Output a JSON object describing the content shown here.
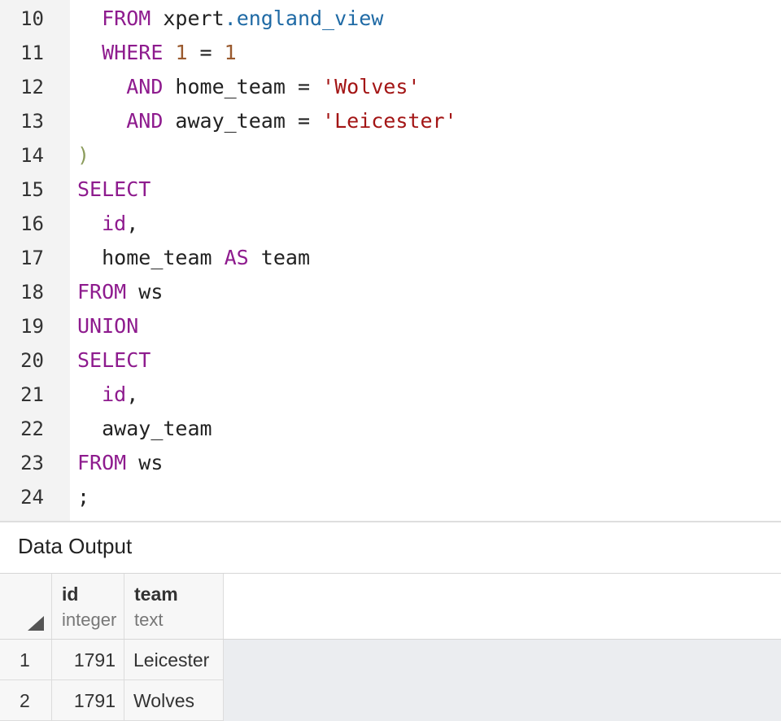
{
  "editor": {
    "colors": {
      "keyword": "#8e1b8e",
      "number": "#9a5a2e",
      "string": "#a31515",
      "property": "#1f6aa5",
      "paren": "#8c9c5c",
      "text": "#222222"
    },
    "lines": [
      {
        "n": "10",
        "indent": "  ",
        "tokens": [
          {
            "t": "FROM",
            "c": "keyword"
          },
          {
            "t": " xpert",
            "c": "text"
          },
          {
            "t": ".england_view",
            "c": "property"
          }
        ]
      },
      {
        "n": "11",
        "indent": "  ",
        "tokens": [
          {
            "t": "WHERE",
            "c": "keyword"
          },
          {
            "t": " ",
            "c": "text"
          },
          {
            "t": "1",
            "c": "number"
          },
          {
            "t": " = ",
            "c": "text"
          },
          {
            "t": "1",
            "c": "number"
          }
        ]
      },
      {
        "n": "12",
        "indent": "    ",
        "tokens": [
          {
            "t": "AND",
            "c": "keyword"
          },
          {
            "t": " home_team = ",
            "c": "text"
          },
          {
            "t": "'Wolves'",
            "c": "string"
          }
        ]
      },
      {
        "n": "13",
        "indent": "    ",
        "tokens": [
          {
            "t": "AND",
            "c": "keyword"
          },
          {
            "t": " away_team = ",
            "c": "text"
          },
          {
            "t": "'Leicester'",
            "c": "string"
          }
        ]
      },
      {
        "n": "14",
        "indent": "",
        "tokens": [
          {
            "t": ")",
            "c": "paren"
          }
        ]
      },
      {
        "n": "15",
        "indent": "",
        "tokens": [
          {
            "t": "SELECT",
            "c": "keyword"
          }
        ]
      },
      {
        "n": "16",
        "indent": "  ",
        "tokens": [
          {
            "t": "id",
            "c": "keyword"
          },
          {
            "t": ",",
            "c": "text"
          }
        ]
      },
      {
        "n": "17",
        "indent": "  ",
        "tokens": [
          {
            "t": "home_team ",
            "c": "text"
          },
          {
            "t": "AS",
            "c": "keyword"
          },
          {
            "t": " team",
            "c": "text"
          }
        ]
      },
      {
        "n": "18",
        "indent": "",
        "tokens": [
          {
            "t": "FROM",
            "c": "keyword"
          },
          {
            "t": " ws",
            "c": "text"
          }
        ]
      },
      {
        "n": "19",
        "indent": "",
        "tokens": [
          {
            "t": "UNION",
            "c": "keyword"
          }
        ]
      },
      {
        "n": "20",
        "indent": "",
        "tokens": [
          {
            "t": "SELECT",
            "c": "keyword"
          }
        ]
      },
      {
        "n": "21",
        "indent": "  ",
        "tokens": [
          {
            "t": "id",
            "c": "keyword"
          },
          {
            "t": ",",
            "c": "text"
          }
        ]
      },
      {
        "n": "22",
        "indent": "  ",
        "tokens": [
          {
            "t": "away_team",
            "c": "text"
          }
        ]
      },
      {
        "n": "23",
        "indent": "",
        "tokens": [
          {
            "t": "FROM",
            "c": "keyword"
          },
          {
            "t": " ws",
            "c": "text"
          }
        ]
      },
      {
        "n": "24",
        "indent": "",
        "tokens": [
          {
            "t": ";",
            "c": "text"
          }
        ]
      }
    ]
  },
  "output": {
    "title": "Data Output",
    "corner_icon": "sort-triangle-icon",
    "columns": [
      {
        "name": "id",
        "type": "integer"
      },
      {
        "name": "team",
        "type": "text"
      }
    ],
    "rows": [
      {
        "num": "1",
        "id": "1791",
        "team": "Leicester"
      },
      {
        "num": "2",
        "id": "1791",
        "team": "Wolves"
      }
    ]
  }
}
